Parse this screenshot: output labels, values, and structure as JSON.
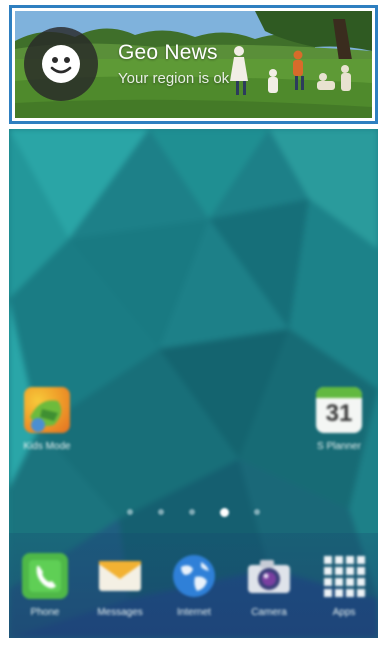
{
  "notification": {
    "app_icon": "smiley-face-icon",
    "title": "Geo News",
    "message": "Your region is ok"
  },
  "home": {
    "wallpaper": "teal-polygon-wallpaper",
    "apps": [
      {
        "label": "Kids Mode",
        "icon": "kids-mode-icon"
      },
      {
        "label": "S Planner",
        "icon": "calendar-icon",
        "badge": "31"
      }
    ],
    "page_indicator": {
      "pages": 5,
      "active_index": 3
    },
    "dock": [
      {
        "label": "Phone",
        "icon": "phone-icon"
      },
      {
        "label": "Messages",
        "icon": "messages-icon"
      },
      {
        "label": "Internet",
        "icon": "globe-icon"
      },
      {
        "label": "Camera",
        "icon": "camera-icon"
      },
      {
        "label": "Apps",
        "icon": "apps-grid-icon"
      }
    ]
  },
  "colors": {
    "notification_border": "#2e7fc0",
    "wallpaper_base": "#1b7f87"
  }
}
